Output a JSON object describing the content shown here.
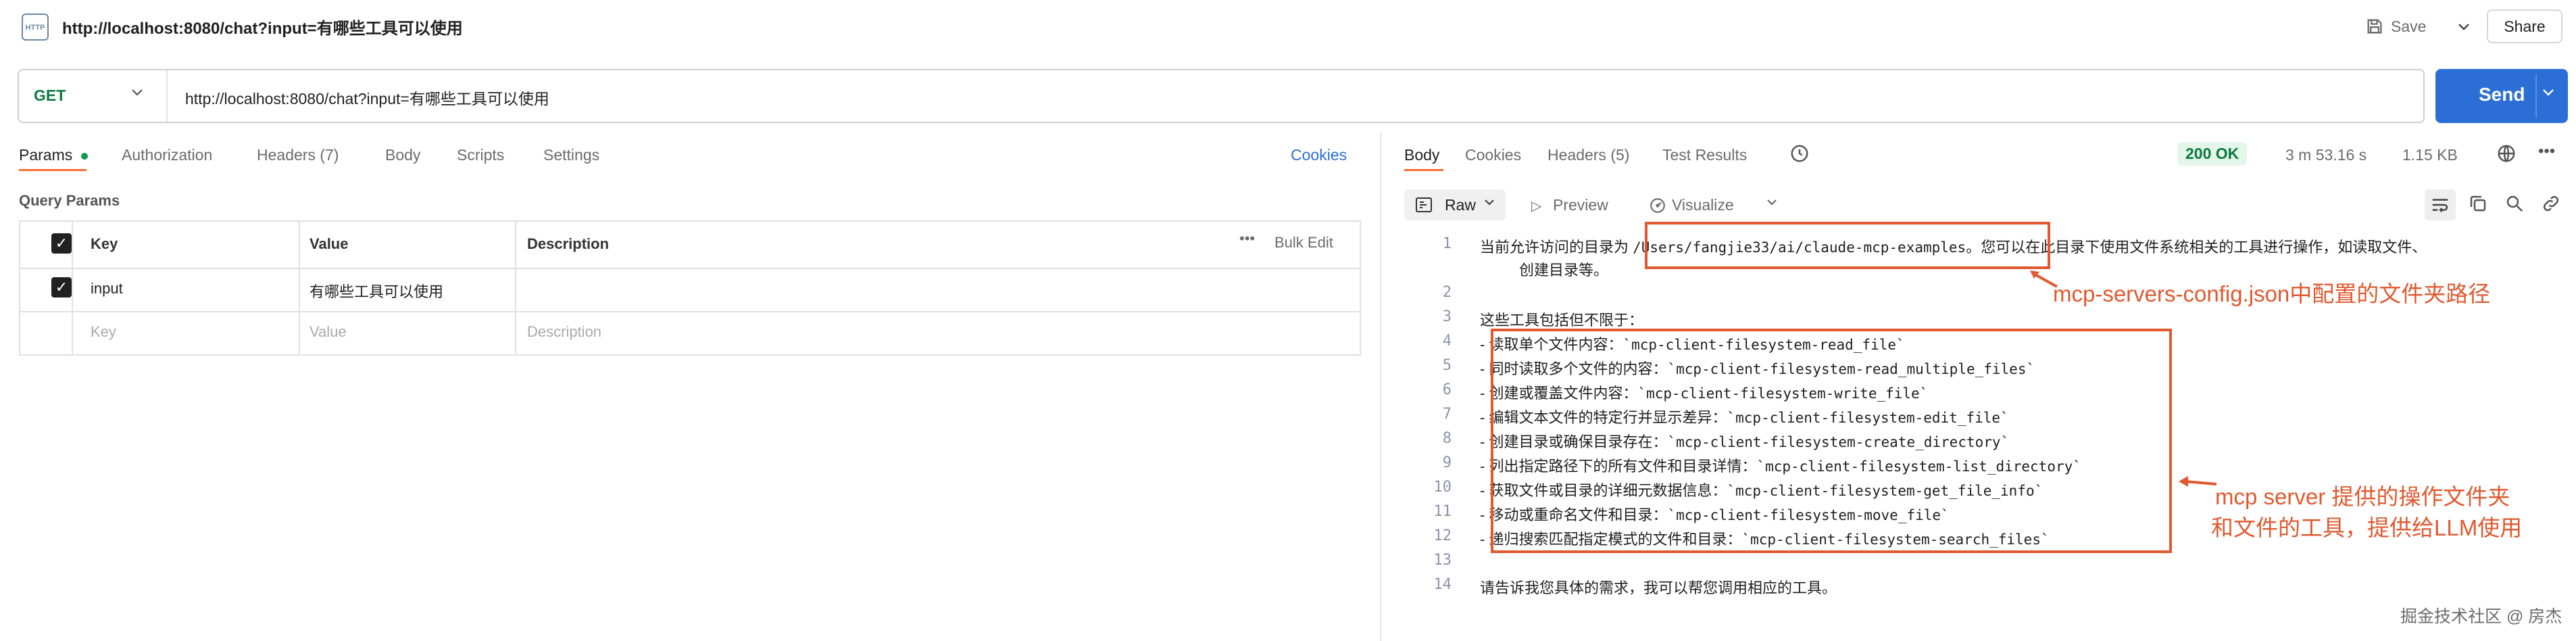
{
  "window": {
    "tab_title": "http://localhost:8080/chat?input=有哪些工具可以使用",
    "http_icon_text": "HTTP",
    "save_label": "Save",
    "share_label": "Share"
  },
  "request": {
    "method": "GET",
    "url": "http://localhost:8080/chat?input=有哪些工具可以使用",
    "send_label": "Send",
    "tabs": {
      "params": "Params",
      "authorization": "Authorization",
      "headers": "Headers (7)",
      "body": "Body",
      "scripts": "Scripts",
      "settings": "Settings"
    },
    "cookies_label": "Cookies",
    "query_params_label": "Query Params",
    "table": {
      "col_key": "Key",
      "col_value": "Value",
      "col_description": "Description",
      "bulk_edit": "Bulk Edit",
      "more": "•••",
      "rows": [
        {
          "key": "input",
          "value": "有哪些工具可以使用",
          "description": "",
          "checked": true
        }
      ],
      "placeholder": {
        "key": "Key",
        "value": "Value",
        "description": "Description"
      }
    }
  },
  "response": {
    "tabs": {
      "body": "Body",
      "cookies": "Cookies",
      "headers": "Headers (5)",
      "test_results": "Test Results"
    },
    "status": "200 OK",
    "time": "3 m 53.16 s",
    "size": "1.15 KB",
    "more": "•••",
    "toolbar": {
      "raw": "Raw",
      "preview": "Preview",
      "visualize": "Visualize"
    },
    "lines": {
      "n1": "1",
      "n2": "2",
      "n3": "3",
      "n4": "4",
      "n5": "5",
      "n6": "6",
      "n7": "7",
      "n8": "8",
      "n9": "9",
      "n10": "10",
      "n11": "11",
      "n12": "12",
      "n13": "13",
      "n14": "14",
      "l1a": "当前允许访问的目录为 ",
      "l1path": "/Users/fangjie33/ai/claude-mcp-examples",
      "l1b": "。您可以在此目录下使用文件系统相关的工具进行操作，如读取文件、",
      "l1c": "创建目录等。",
      "l3": "这些工具包括但不限于：",
      "l4a": "- 读取单个文件内容：",
      "l4b": "`mcp-client-filesystem-read_file`",
      "l5a": "- 同时读取多个文件的内容：",
      "l5b": "`mcp-client-filesystem-read_multiple_files`",
      "l6a": "- 创建或覆盖文件内容：",
      "l6b": "`mcp-client-filesystem-write_file`",
      "l7a": "- 编辑文本文件的特定行并显示差异：",
      "l7b": "`mcp-client-filesystem-edit_file`",
      "l8a": "- 创建目录或确保目录存在：",
      "l8b": "`mcp-client-filesystem-create_directory`",
      "l9a": "- 列出指定路径下的所有文件和目录详情：",
      "l9b": "`mcp-client-filesystem-list_directory`",
      "l10a": "- 获取文件或目录的详细元数据信息：",
      "l10b": "`mcp-client-filesystem-get_file_info`",
      "l11a": "- 移动或重命名文件和目录：",
      "l11b": "`mcp-client-filesystem-move_file`",
      "l12a": "- 递归搜索匹配指定模式的文件和目录：",
      "l12b": "`mcp-client-filesystem-search_files`",
      "l14": "请告诉我您具体的需求，我可以帮您调用相应的工具。"
    }
  },
  "annotations": {
    "config_note": "mcp-servers-config.json中配置的文件夹路径",
    "tools_note_1": "mcp server 提供的操作文件夹",
    "tools_note_2": "和文件的工具，提供给LLM使用"
  },
  "watermark": "掘金技术社区 @ 房杰",
  "colors": {
    "accent_orange": "#ff6c37",
    "send_blue": "#2b6fd6",
    "get_green": "#0b7a3e",
    "annotation_red": "#e0592f"
  }
}
